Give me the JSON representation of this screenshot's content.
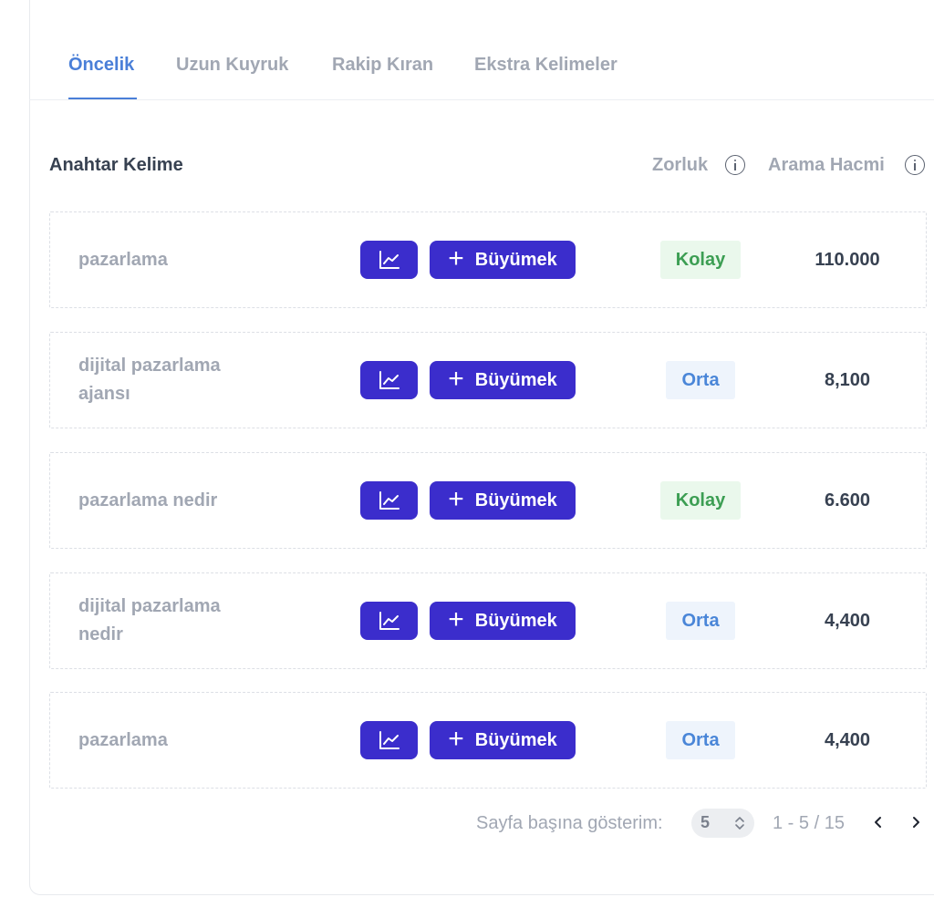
{
  "tabs": [
    {
      "label": "Öncelik",
      "active": true
    },
    {
      "label": "Uzun Kuyruk",
      "active": false
    },
    {
      "label": "Rakip Kıran",
      "active": false
    },
    {
      "label": "Ekstra Kelimeler",
      "active": false
    }
  ],
  "table": {
    "headers": {
      "keyword": "Anahtar Kelime",
      "difficulty": "Zorluk",
      "volume": "Arama Hacmi"
    },
    "grow_label": "Büyümek",
    "rows": [
      {
        "keyword": "pazarlama",
        "difficulty": "Kolay",
        "level": "easy",
        "volume": "110.000"
      },
      {
        "keyword": "dijital pazarlama ajansı",
        "difficulty": "Orta",
        "level": "medium",
        "volume": "8,100"
      },
      {
        "keyword": "pazarlama nedir",
        "difficulty": "Kolay",
        "level": "easy",
        "volume": "6.600"
      },
      {
        "keyword": "dijital pazarlama nedir",
        "difficulty": "Orta",
        "level": "medium",
        "volume": "4,400"
      },
      {
        "keyword": "pazarlama",
        "difficulty": "Orta",
        "level": "medium",
        "volume": "4,400"
      }
    ]
  },
  "pagination": {
    "per_page_label": "Sayfa başına gösterim:",
    "per_page_value": "5",
    "range_text": "1 - 5 / 15"
  },
  "colors": {
    "accent": "#4a7fd8",
    "button": "#3b2dcc",
    "easy_text": "#3c9e53",
    "easy_bg": "#eaf8ec",
    "medium_text": "#4a86d8",
    "medium_bg": "#eef4fc"
  },
  "icons": {
    "chart_button": "line-chart-icon",
    "grow_button": "plus-icon",
    "info": "info-icon",
    "select": "chevron-up-down-icon",
    "prev": "chevron-left-icon",
    "next": "chevron-right-icon"
  }
}
